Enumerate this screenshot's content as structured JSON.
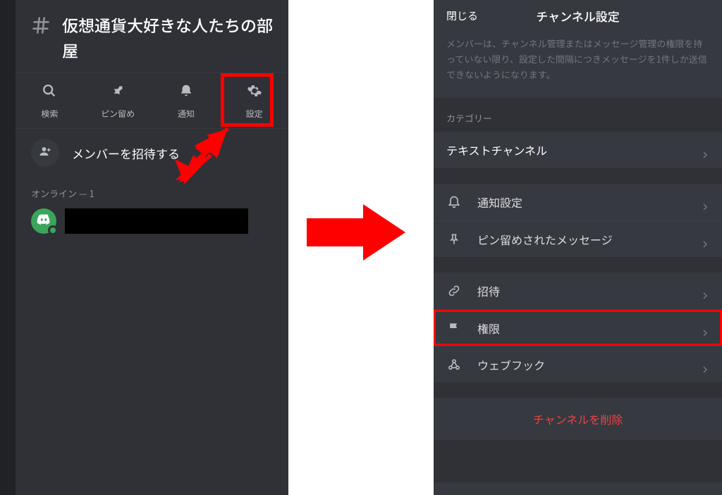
{
  "left": {
    "channel_name": "仮想通貨大好きな人たちの部屋",
    "tabs": {
      "search": "検索",
      "pin": "ピン留め",
      "notify": "通知",
      "settings": "設定"
    },
    "invite_label": "メンバーを招待する",
    "online_label": "オンライン — 1"
  },
  "right": {
    "close": "閉じる",
    "title": "チャンネル設定",
    "description": "メンバーは、チャンネル管理またはメッセージ管理の権限を持っていない限り、設定した間隔につきメッセージを1件しか送信できないようになります。",
    "category_label": "カテゴリー",
    "items": {
      "text_channel": "テキストチャンネル",
      "notification": "通知設定",
      "pinned": "ピン留めされたメッセージ",
      "invite": "招待",
      "permissions": "権限",
      "webhook": "ウェブフック"
    },
    "delete": "チャンネルを削除"
  }
}
